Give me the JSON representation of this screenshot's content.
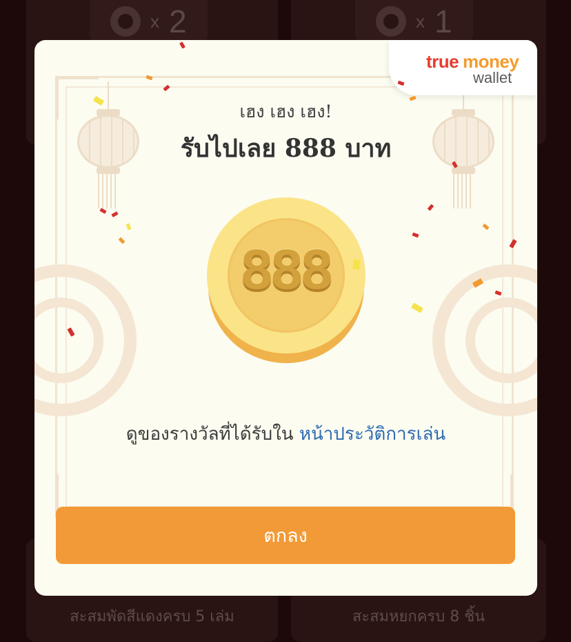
{
  "background": {
    "left_card": {
      "count_prefix": "x",
      "count": "2",
      "caption": "สะสมพัดสีแดงครบ 5 เล่ม"
    },
    "right_card": {
      "count_prefix": "x",
      "count": "1",
      "caption": "สะสมหยกครบ 8 ชิ้น"
    }
  },
  "modal": {
    "logo": {
      "brand_true": "true",
      "brand_money": "money",
      "brand_wallet": "wallet"
    },
    "subtitle": "เฮง เฮง เฮง!",
    "title": "รับไปเลย 888 บาท",
    "coin_value": "888",
    "history_text": "ดูของรางวัลที่ได้รับใน",
    "history_link": "หน้าประวัติการเล่น",
    "ok_button": "ตกลง"
  },
  "colors": {
    "accent": "#f29a37",
    "link": "#2e6bb4",
    "modal_bg": "#fcfcf1",
    "page_bg": "#1d0909"
  },
  "icons": [
    "apple-icon",
    "lantern-icon",
    "coin-icon",
    "confetti"
  ]
}
